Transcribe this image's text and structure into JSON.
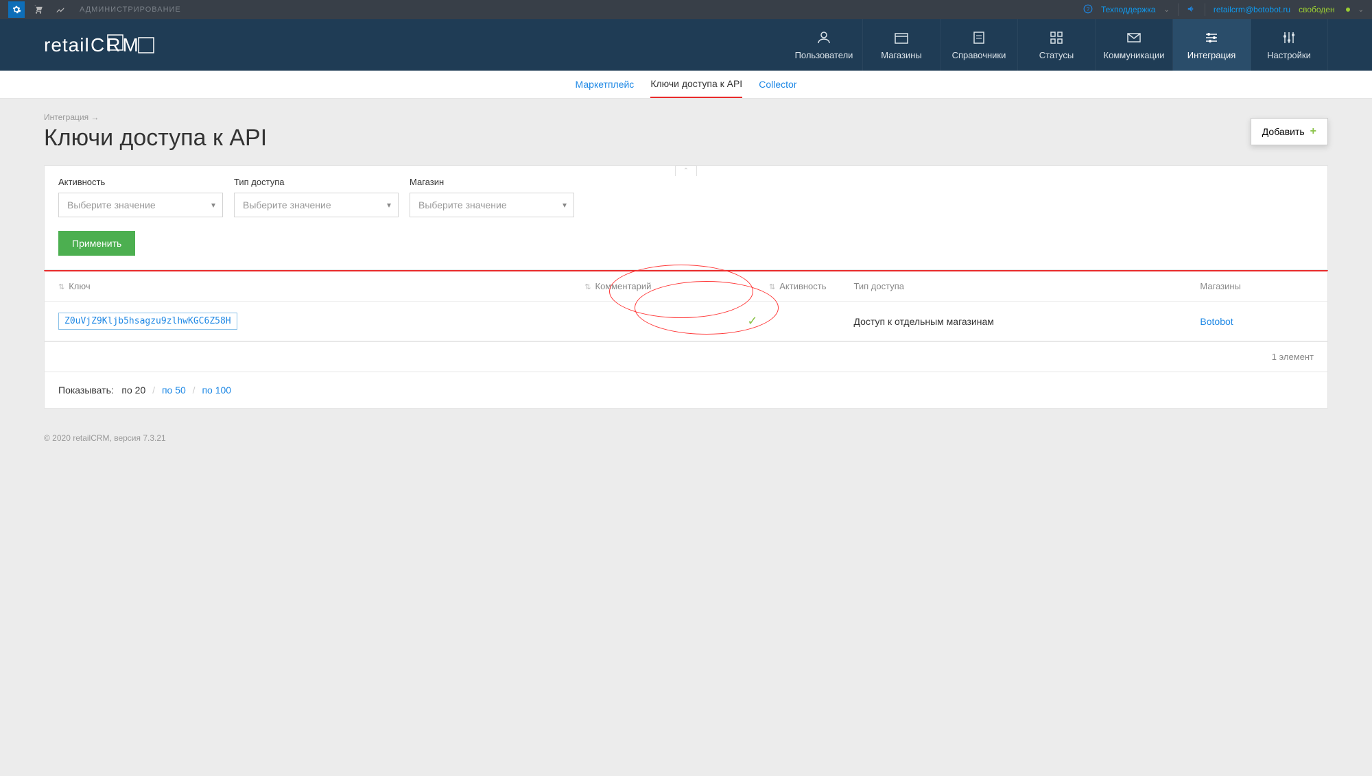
{
  "topbar": {
    "admin_label": "АДМИНИСТРИРОВАНИЕ",
    "support": "Техподдержка",
    "user_email": "retailcrm@botobot.ru",
    "status": "свободен"
  },
  "header": {
    "logo": "retailCRM",
    "nav": [
      {
        "label": "Пользователи"
      },
      {
        "label": "Магазины"
      },
      {
        "label": "Справочники"
      },
      {
        "label": "Статусы"
      },
      {
        "label": "Коммуникации"
      },
      {
        "label": "Интеграция",
        "active": true
      },
      {
        "label": "Настройки"
      }
    ]
  },
  "subnav": {
    "tabs": [
      {
        "label": "Маркетплейс"
      },
      {
        "label": "Ключи доступа к API",
        "active": true
      },
      {
        "label": "Collector"
      }
    ]
  },
  "breadcrumb": "Интеграция →",
  "page_title": "Ключи доступа к API",
  "add_button": "Добавить",
  "filters": {
    "activity": {
      "label": "Активность",
      "placeholder": "Выберите значение"
    },
    "access_type": {
      "label": "Тип доступа",
      "placeholder": "Выберите значение"
    },
    "store": {
      "label": "Магазин",
      "placeholder": "Выберите значение"
    },
    "apply": "Применить"
  },
  "table": {
    "headers": {
      "key": "Ключ",
      "comment": "Комментарий",
      "activity": "Активность",
      "access_type": "Тип доступа",
      "stores": "Магазины"
    },
    "rows": [
      {
        "key": "Z0uVjZ9Kljb5hsagzu9zlhwKGC6Z58H",
        "comment": "",
        "activity": true,
        "access_type": "Доступ к отдельным магазинам",
        "store": "Botobot"
      }
    ],
    "count_label": "1 элемент"
  },
  "pager": {
    "label": "Показывать:",
    "opt20": "по 20",
    "opt50": "по 50",
    "opt100": "по 100"
  },
  "footer": "© 2020 retailCRM, версия 7.3.21"
}
